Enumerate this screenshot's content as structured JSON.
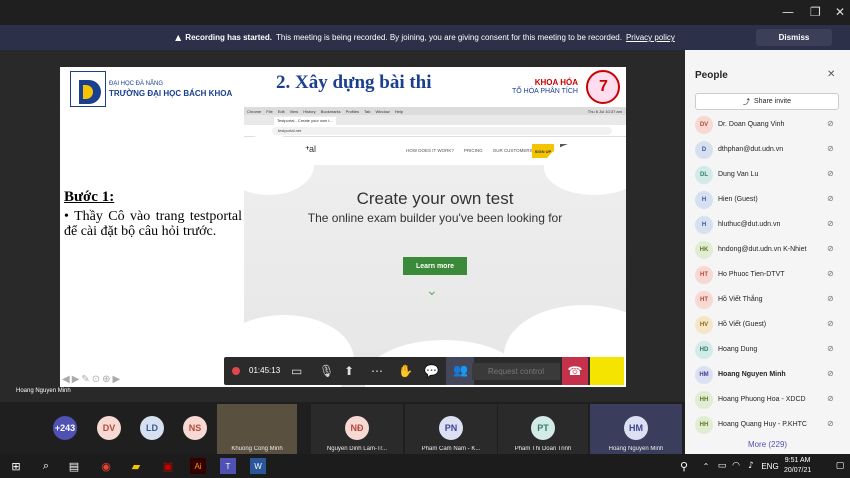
{
  "banner": {
    "bold": "Recording has started.",
    "text": "This meeting is being recorded. By joining, you are giving consent for this meeting to be recorded.",
    "link": "Privacy policy",
    "dismiss": "Dismiss"
  },
  "slide": {
    "uni_small": "ĐẠI HỌC ĐÀ NẴNG",
    "uni_big": "TRƯỜNG ĐẠI HỌC BÁCH KHOA",
    "title": "2. Xây dựng bài thi",
    "khoa": "KHOA HÓA",
    "tohoa": "TỔ HÓA PHÂN TÍCH",
    "buoc": "Bước 1:",
    "body": "• Thầy Cô vào trang testportal để cài đặt bộ câu hỏi trước."
  },
  "web": {
    "tab_title": "Testportal - Create your own t...",
    "url": "testportal.net",
    "logo": "testportal",
    "nav": [
      "HOW DOES IT WORK?",
      "PRICING",
      "OUR CUSTOMERS"
    ],
    "signup": "SIGN UP",
    "signin": "SIGN IN",
    "hero_title": "Create your own test",
    "hero_sub": "The online exam builder you've been looking for",
    "learn": "Learn more",
    "mac_menu": [
      "Chrome",
      "File",
      "Edit",
      "View",
      "History",
      "Bookmarks",
      "Profiles",
      "Tab",
      "Window",
      "Help"
    ],
    "mac_time": "Thu 6 Jul 10:37 am"
  },
  "call": {
    "timer": "01:45:13",
    "request": "Request control"
  },
  "presenter": "Hoang Nguyen Minh",
  "strip": {
    "count": "+243",
    "avatars": [
      "DV",
      "LD",
      "NS"
    ],
    "tiles": [
      {
        "name": "Khuong Cong Minh",
        "initials": ""
      },
      {
        "name": "Nguyen Dinh Lam-Tr...",
        "initials": "NĐ"
      },
      {
        "name": "Pham Cam Nam - K...",
        "initials": "PN"
      },
      {
        "name": "Pham Thi Doan Trinh",
        "initials": "PT"
      },
      {
        "name": "Hoang Nguyen Minh",
        "initials": "HM"
      }
    ]
  },
  "people": {
    "title": "People",
    "share": "Share invite",
    "list": [
      {
        "initials": "DV",
        "name": "Dr. Doan Quang Vinh",
        "color": "#f7d8d2",
        "fg": "#b34a3a"
      },
      {
        "initials": "D",
        "name": "dthphan@dut.udn.vn",
        "color": "#d6e0f0",
        "fg": "#3b5b8f"
      },
      {
        "initials": "DL",
        "name": "Dung Van Lu",
        "color": "#d3ebe6",
        "fg": "#2f7f6b"
      },
      {
        "initials": "H",
        "name": "Hien (Guest)",
        "color": "#d6e0f0",
        "fg": "#3b5b8f"
      },
      {
        "initials": "H",
        "name": "hluthuc@dut.udn.vn",
        "color": "#d6e0f0",
        "fg": "#3b5b8f"
      },
      {
        "initials": "HK",
        "name": "hndong@dut.udn.vn K-Nhiet",
        "color": "#e2ecd2",
        "fg": "#5a7a2a"
      },
      {
        "initials": "HT",
        "name": "Ho Phuoc Tien-DTVT",
        "color": "#f7d8d2",
        "fg": "#b34a3a"
      },
      {
        "initials": "HT",
        "name": "Hồ Viết Thắng",
        "color": "#f7d8d2",
        "fg": "#b34a3a"
      },
      {
        "initials": "HV",
        "name": "Hồ Viết (Guest)",
        "color": "#f5e6c8",
        "fg": "#8a6a1a"
      },
      {
        "initials": "HD",
        "name": "Hoang Dung",
        "color": "#d3ebe6",
        "fg": "#2f7f6b"
      },
      {
        "initials": "HM",
        "name": "Hoang Nguyen Minh",
        "color": "#dde0f3",
        "fg": "#3f4494",
        "bold": true
      },
      {
        "initials": "HH",
        "name": "Hoang Phuong Hoa - XDCD",
        "color": "#e2ecd2",
        "fg": "#5a7a2a"
      },
      {
        "initials": "HH",
        "name": "Hoang Quang Huy - P.KHTC",
        "color": "#e2ecd2",
        "fg": "#5a7a2a"
      }
    ],
    "more": "More (229)"
  },
  "taskbar": {
    "lang": "ENG",
    "time": "9:51 AM",
    "date": "20/07/21"
  }
}
